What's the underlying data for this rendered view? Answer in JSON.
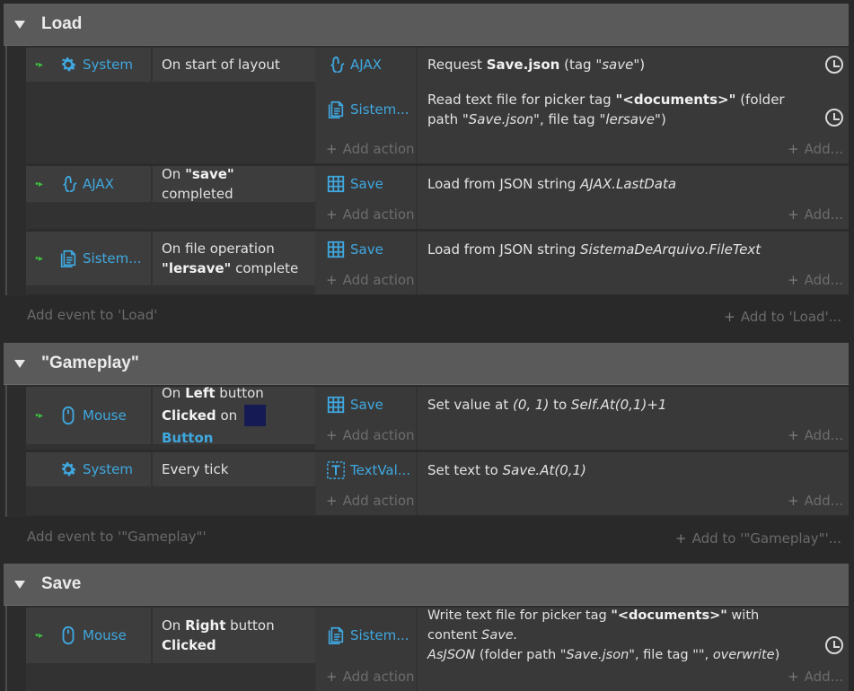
{
  "groups": {
    "load": {
      "title": "Load",
      "add_event": "Add event to 'Load'",
      "add_to": "Add to 'Load'..."
    },
    "gameplay": {
      "title": "\"Gameplay\"",
      "add_event": "Add event to '\"Gameplay\"'",
      "add_to": "Add to '\"Gameplay\"'..."
    },
    "save": {
      "title": "Save"
    }
  },
  "common": {
    "add_action": "Add action",
    "add": "Add..."
  },
  "objects": {
    "system": "System",
    "ajax": "AJAX",
    "sistem": "Sistem...",
    "save": "Save",
    "mouse": "Mouse",
    "textval": "TextVal..."
  },
  "events": {
    "e1": {
      "cond": "On start of layout",
      "a1": {
        "pre": "Request ",
        "b": "Save.json",
        "mid": " (tag ",
        "i": "\"save\"",
        "post": ")"
      },
      "a2": {
        "pre": "Read text file for picker tag ",
        "b": "\"<documents>\"",
        "mid": " (folder path ",
        "i1": "\"Save.json\"",
        "mid2": ", file tag ",
        "i2": "\"lersave\"",
        "post": ")"
      }
    },
    "e2": {
      "cond_pre": "On ",
      "cond_b": "\"save\"",
      "cond_post": " completed",
      "a1": {
        "pre": "Load from JSON string ",
        "i": "AJAX.LastData"
      }
    },
    "e3": {
      "cond_l1": "On file operation",
      "cond_b": "\"lersave\"",
      "cond_post": " complete",
      "a1": {
        "pre": "Load from JSON string ",
        "i": "SistemaDeArquivo.FileText"
      }
    },
    "e4": {
      "cond_pre": "On ",
      "cond_b1": "Left",
      "cond_mid": " button",
      "cond_b2": "Clicked",
      "cond_on": " on ",
      "cond_btn": "Button",
      "a1": {
        "pre": "Set value at ",
        "i1": "(0, 1)",
        "mid": " to ",
        "i2": "Self.At(0,1)+1"
      }
    },
    "e5": {
      "cond": "Every tick",
      "a1": {
        "pre": "Set text to ",
        "i": "Save.At(0,1)"
      }
    },
    "e6": {
      "cond_pre": "On ",
      "cond_b1": "Right",
      "cond_mid": " button",
      "cond_b2": "Clicked",
      "a1": {
        "pre": "Write text file for picker tag ",
        "b": "\"<documents>\"",
        "mid": " with content ",
        "i1": "Save.",
        "i1b": "AsJSON",
        "mid2": " (folder path ",
        "i2": "\"Save.json\"",
        "mid3": ", file tag ",
        "q": "\"\"",
        "mid4": ", ",
        "i3": "overwrite",
        "post": ")"
      }
    }
  },
  "colors": {
    "accent": "#3fa8e0",
    "header": "#5a5a5a",
    "trigger": "#3fbf3f"
  }
}
